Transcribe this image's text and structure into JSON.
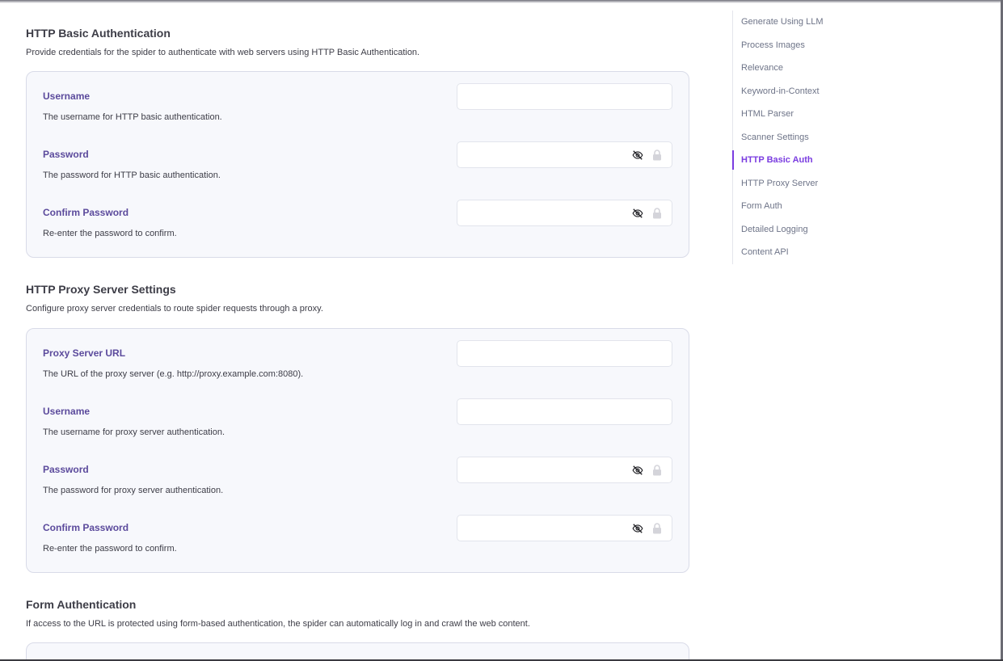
{
  "sections": {
    "basic": {
      "title": "HTTP Basic Authentication",
      "description": "Provide credentials for the spider to authenticate with web servers using HTTP Basic Authentication.",
      "fields": [
        {
          "label": "Username",
          "help": "The username for HTTP basic authentication.",
          "value": "",
          "type": "text"
        },
        {
          "label": "Password",
          "help": "The password for HTTP basic authentication.",
          "value": "",
          "type": "password"
        },
        {
          "label": "Confirm Password",
          "help": "Re-enter the password to confirm.",
          "value": "",
          "type": "password"
        }
      ]
    },
    "proxy": {
      "title": "HTTP Proxy Server Settings",
      "description": "Configure proxy server credentials to route spider requests through a proxy.",
      "fields": [
        {
          "label": "Proxy Server URL",
          "help": "The URL of the proxy server (e.g. http://proxy.example.com:8080).",
          "value": "",
          "type": "text"
        },
        {
          "label": "Username",
          "help": "The username for proxy server authentication.",
          "value": "",
          "type": "text"
        },
        {
          "label": "Password",
          "help": "The password for proxy server authentication.",
          "value": "",
          "type": "password"
        },
        {
          "label": "Confirm Password",
          "help": "Re-enter the password to confirm.",
          "value": "",
          "type": "password"
        }
      ]
    },
    "form": {
      "title": "Form Authentication",
      "description": "If access to the URL is protected using form-based authentication, the spider can automatically log in and crawl the web content."
    }
  },
  "toc": {
    "items": [
      {
        "label": "Generate Using LLM",
        "active": false
      },
      {
        "label": "Process Images",
        "active": false
      },
      {
        "label": "Relevance",
        "active": false
      },
      {
        "label": "Keyword-in-Context",
        "active": false
      },
      {
        "label": "HTML Parser",
        "active": false
      },
      {
        "label": "Scanner Settings",
        "active": false
      },
      {
        "label": "HTTP Basic Auth",
        "active": true
      },
      {
        "label": "HTTP Proxy Server",
        "active": false
      },
      {
        "label": "Form Auth",
        "active": false
      },
      {
        "label": "Detailed Logging",
        "active": false
      },
      {
        "label": "Content API",
        "active": false
      }
    ]
  },
  "icons": {
    "password_toggle": "eye-off-icon",
    "password_lock": "lock-icon"
  },
  "colors": {
    "accent": "#7a3ce0",
    "label": "#5b4a9c",
    "card_bg": "#f7f8fc",
    "card_border": "#d9dbe8"
  }
}
